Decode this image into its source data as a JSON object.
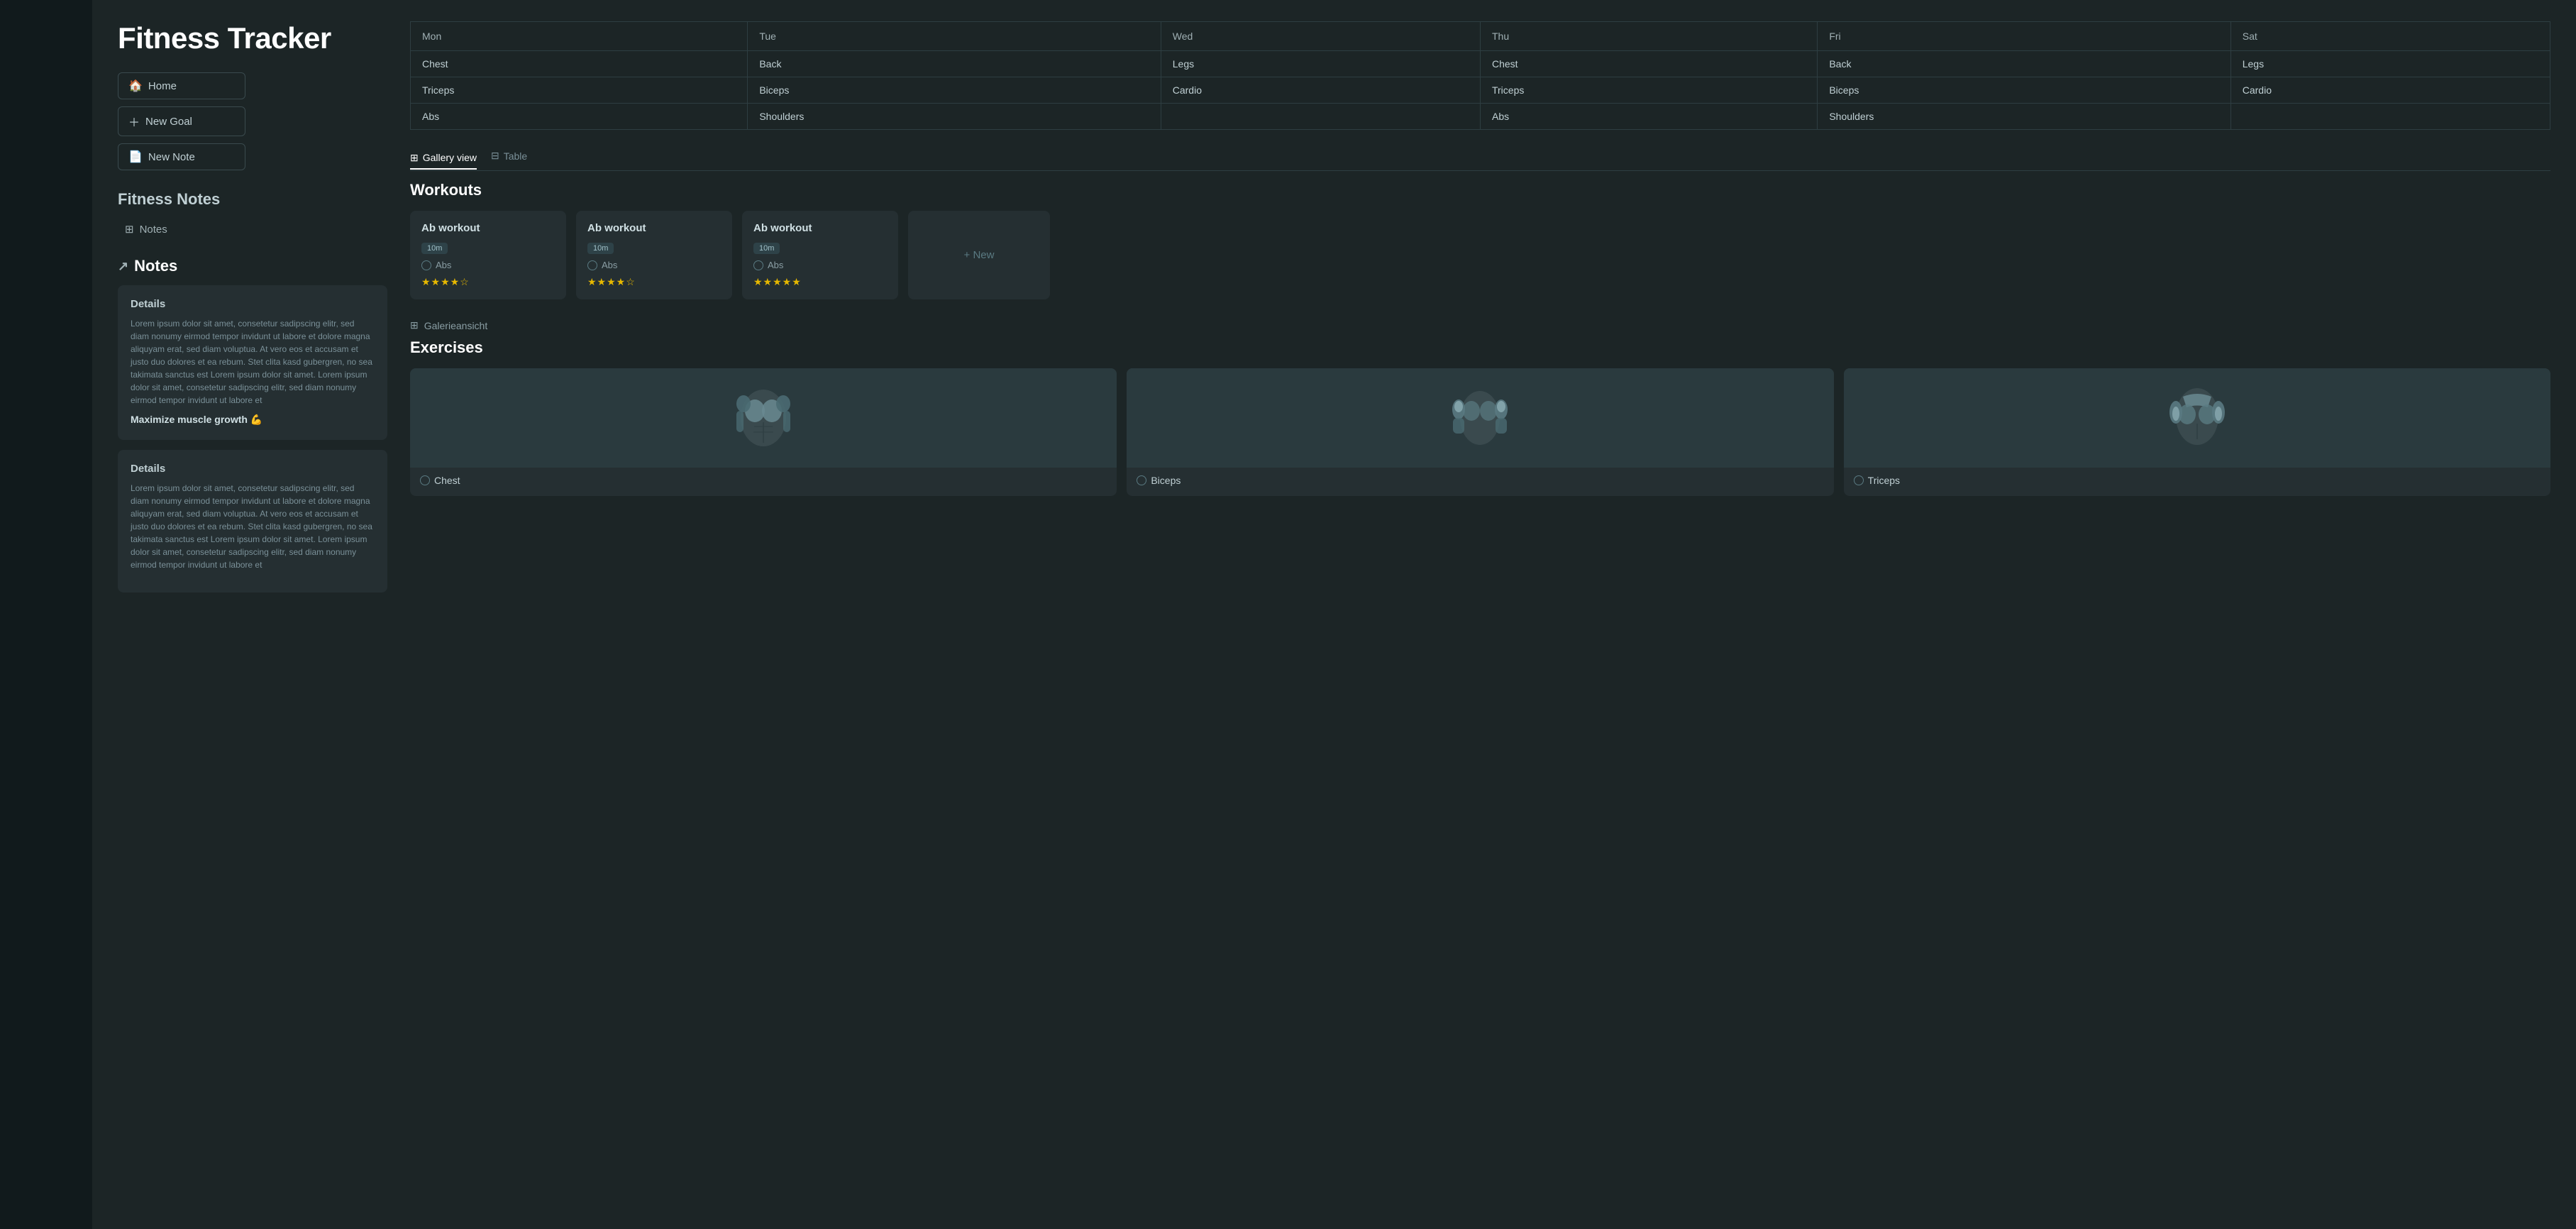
{
  "sidebar": {},
  "leftPanel": {
    "pageTitle": "Fitness Tracker",
    "nav": [
      {
        "label": "Home",
        "icon": "🏠",
        "id": "home"
      },
      {
        "label": "New Goal",
        "icon": "+",
        "id": "new-goal"
      },
      {
        "label": "New Note",
        "icon": "📄",
        "id": "new-note"
      }
    ],
    "fitnessNotesHeading": "Fitness Notes",
    "notesNavLabel": "Notes",
    "notesSectionHeader": "Notes",
    "noteCards": [
      {
        "label": "Details",
        "body": "Lorem ipsum dolor sit amet, consetetur sadipscing elitr, sed diam nonumy eirmod tempor invidunt ut labore et dolore magna aliquyam erat, sed diam voluptua. At vero eos et accusam et justo duo dolores et ea rebum. Stet clita kasd gubergren, no sea takimata sanctus est Lorem ipsum dolor sit amet. Lorem ipsum dolor sit amet, consetetur sadipscing elitr, sed diam nonumy eirmod tempor invidunt ut labore et",
        "highlight": "Maximize muscle growth 💪"
      },
      {
        "label": "Details",
        "body": "Lorem ipsum dolor sit amet, consetetur sadipscing elitr, sed diam nonumy eirmod tempor invidunt ut labore et dolore magna aliquyam erat, sed diam voluptua. At vero eos et accusam et justo duo dolores et ea rebum. Stet clita kasd gubergren, no sea takimata sanctus est Lorem ipsum dolor sit amet. Lorem ipsum dolor sit amet, consetetur sadipscing elitr, sed diam nonumy eirmod tempor invidunt ut labore et",
        "highlight": ""
      }
    ]
  },
  "rightPanel": {
    "schedule": {
      "columns": [
        "Mon",
        "Tue",
        "Wed",
        "Thu",
        "Fri",
        "Sat"
      ],
      "rows": [
        [
          "Chest",
          "Back",
          "Legs",
          "Chest",
          "Back",
          "Legs"
        ],
        [
          "Triceps",
          "Biceps",
          "Cardio",
          "Triceps",
          "Biceps",
          "Cardio"
        ],
        [
          "Abs",
          "Shoulders",
          "",
          "Abs",
          "Shoulders",
          ""
        ]
      ]
    },
    "viewTabs": [
      {
        "label": "Gallery view",
        "icon": "⊞",
        "active": true
      },
      {
        "label": "Table",
        "icon": "⊟",
        "active": false
      }
    ],
    "workoutsSection": {
      "title": "Workouts",
      "cards": [
        {
          "title": "Ab workout",
          "badge": "10m",
          "tag": "Abs",
          "stars": 4
        },
        {
          "title": "Ab workout",
          "badge": "10m",
          "tag": "Abs",
          "stars": 4
        },
        {
          "title": "Ab workout",
          "badge": "10m",
          "tag": "Abs",
          "stars": 5
        }
      ],
      "newLabel": "+ New"
    },
    "gallerySection": {
      "label": "Galerieansicht"
    },
    "exercisesSection": {
      "title": "Exercises",
      "items": [
        {
          "name": "Chest"
        },
        {
          "name": "Biceps"
        },
        {
          "name": "Triceps"
        }
      ]
    }
  }
}
